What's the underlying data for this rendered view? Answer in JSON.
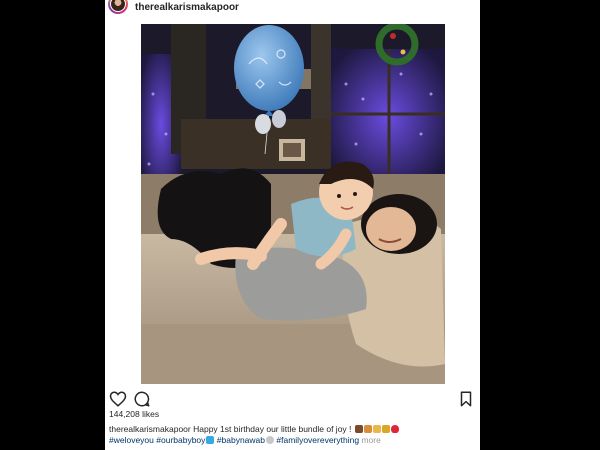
{
  "post": {
    "username": "therealkarismakapoor",
    "likes": "144,208 likes",
    "caption": {
      "username": "therealkarismakapoor",
      "text": "Happy 1st birthday our little bundle of joy !",
      "hashtags": [
        "#weloveyou",
        "#ourbabyboy",
        "#babynawab",
        "#familyovereverything"
      ],
      "more": "more"
    }
  },
  "colors": {
    "background": "#000000",
    "card": "#ffffff",
    "text": "#262626",
    "hashtag": "#003569",
    "balloon": "#5b9bd5",
    "couch": "#b8a58f"
  },
  "icons": {
    "like": "heart-outline-icon",
    "comment": "speech-bubble-icon",
    "save": "bookmark-icon"
  }
}
